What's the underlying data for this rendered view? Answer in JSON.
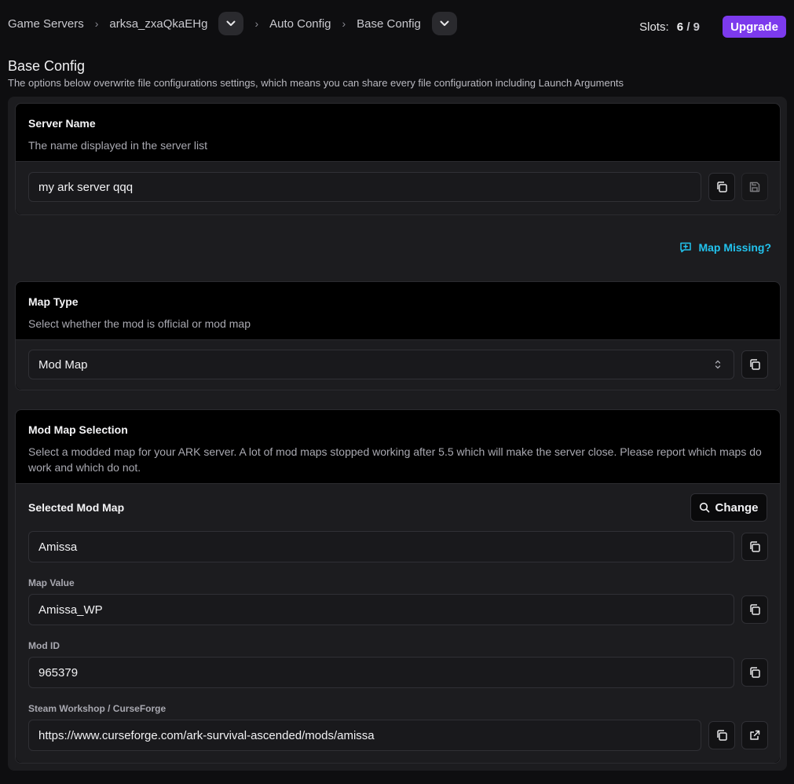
{
  "breadcrumb": {
    "items": [
      "Game Servers",
      "arksa_zxaQkaEHg",
      "Auto Config",
      "Base Config"
    ]
  },
  "slots": {
    "label": "Slots:",
    "used": "6",
    "sep": "/",
    "total": "9"
  },
  "upgrade_label": "Upgrade",
  "page": {
    "title": "Base Config",
    "subtitle": "The options below overwrite file configurations settings, which means you can share every file configuration including Launch Arguments"
  },
  "server_name": {
    "title": "Server Name",
    "desc": "The name displayed in the server list",
    "value": "my ark server qqq"
  },
  "map_missing_label": "Map Missing?",
  "map_type": {
    "title": "Map Type",
    "desc": "Select whether the mod is official or mod map",
    "value": "Mod Map"
  },
  "mod_map": {
    "title": "Mod Map Selection",
    "desc": "Select a modded map for your ARK server. A lot of mod maps stopped working after 5.5 which will make the server close. Please report which maps do work and which do not.",
    "selected_label": "Selected Mod Map",
    "change_label": "Change",
    "selected_value": "Amissa",
    "map_value_label": "Map Value",
    "map_value": "Amissa_WP",
    "mod_id_label": "Mod ID",
    "mod_id": "965379",
    "workshop_label": "Steam Workshop / CurseForge",
    "workshop_url": "https://www.curseforge.com/ark-survival-ascended/mods/amissa"
  },
  "colors": {
    "accent": "#7c3aed",
    "link": "#22c3ee"
  }
}
